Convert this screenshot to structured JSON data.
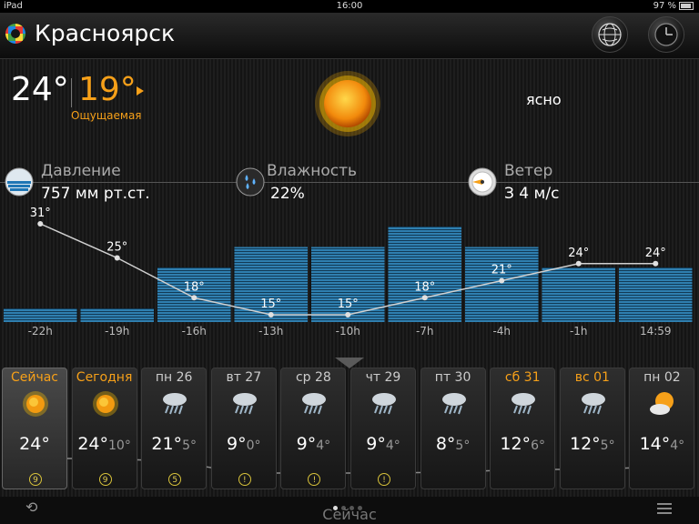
{
  "status": {
    "device": "iPad",
    "time": "16:00",
    "battery": "97 %"
  },
  "header": {
    "city": "Красноярск"
  },
  "current": {
    "temp": "24°",
    "feels": "19°",
    "feels_label": "Ощущаемая",
    "condition": "ясно",
    "pressure_label": "Давление",
    "pressure_value": "757 мм рт.ст.",
    "humidity_label": "Влажность",
    "humidity_value": "22%",
    "wind_label": "Ветер",
    "wind_value": "З   4 м/с"
  },
  "colors": {
    "accent": "#f6a019",
    "bar": "#2f7fb0"
  },
  "chart_data": {
    "type": "line",
    "categories": [
      "-22h",
      "-19h",
      "-16h",
      "-13h",
      "-10h",
      "-7h",
      "-4h",
      "-1h",
      "14:59"
    ],
    "series": [
      {
        "values": [
          31,
          25,
          18,
          15,
          15,
          18,
          21,
          24,
          24
        ]
      }
    ],
    "value_labels": [
      "31°",
      "25°",
      "18°",
      "15°",
      "15°",
      "18°",
      "21°",
      "24°",
      "24°"
    ],
    "bars": [
      0.1,
      0.1,
      0.4,
      0.55,
      0.55,
      0.7,
      0.55,
      0.4,
      0.4
    ]
  },
  "days": [
    {
      "name": "Сейчас",
      "temp": "24°",
      "low": "",
      "icon": "sun-icon",
      "badge": "9",
      "highlight": true,
      "selected": true
    },
    {
      "name": "Сегодня",
      "temp": "24°",
      "low": "10°",
      "icon": "sun-icon",
      "badge": "9",
      "highlight": true,
      "selected": false
    },
    {
      "name": "пн 26",
      "temp": "21°",
      "low": "5°",
      "icon": "storm-icon",
      "badge": "5",
      "highlight": false,
      "selected": false
    },
    {
      "name": "вт 27",
      "temp": "9°",
      "low": "0°",
      "icon": "storm-icon",
      "badge": "!",
      "highlight": false,
      "selected": false
    },
    {
      "name": "ср 28",
      "temp": "9°",
      "low": "4°",
      "icon": "storm-icon",
      "badge": "!",
      "highlight": false,
      "selected": false
    },
    {
      "name": "чт 29",
      "temp": "9°",
      "low": "4°",
      "icon": "storm-icon",
      "badge": "!",
      "highlight": false,
      "selected": false
    },
    {
      "name": "пт 30",
      "temp": "8°",
      "low": "5°",
      "icon": "storm-icon",
      "badge": "",
      "highlight": false,
      "selected": false
    },
    {
      "name": "сб 31",
      "temp": "12°",
      "low": "6°",
      "icon": "storm-icon",
      "badge": "",
      "highlight": true,
      "selected": false
    },
    {
      "name": "вс 01",
      "temp": "12°",
      "low": "5°",
      "icon": "storm-icon",
      "badge": "",
      "highlight": true,
      "selected": false
    },
    {
      "name": "пн 02",
      "temp": "14°",
      "low": "4°",
      "icon": "partly-cloudy-icon",
      "badge": "",
      "highlight": false,
      "selected": false
    }
  ],
  "bottom": {
    "label": "Сейчас"
  }
}
